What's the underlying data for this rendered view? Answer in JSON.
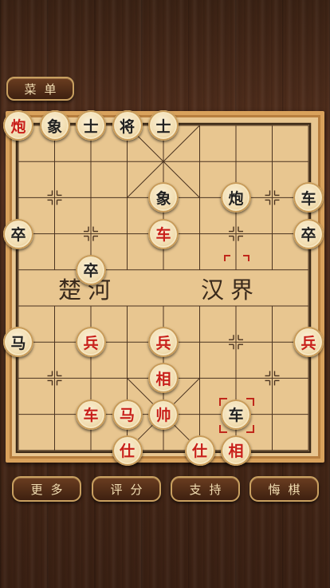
{
  "menu": {
    "label": "菜单"
  },
  "river": {
    "left": "楚河",
    "right": "汉界"
  },
  "bottom_bar": [
    {
      "id": "more",
      "label": "更多"
    },
    {
      "id": "rate",
      "label": "评分"
    },
    {
      "id": "support",
      "label": "支持"
    },
    {
      "id": "undo",
      "label": "悔棋"
    }
  ],
  "colors": {
    "red_piece_text": "#c81f1a",
    "black_piece_text": "#222222",
    "board": "#e8c690",
    "frame": "#d9a25c"
  },
  "pieces": [
    {
      "id": "b-pao",
      "text": "炮",
      "side": "red",
      "file": 0,
      "rank": 0
    },
    {
      "id": "b-xiang-top",
      "text": "象",
      "side": "black",
      "file": 1,
      "rank": 0
    },
    {
      "id": "b-shi-top-l",
      "text": "士",
      "side": "black",
      "file": 2,
      "rank": 0
    },
    {
      "id": "b-jiang",
      "text": "将",
      "side": "black",
      "file": 3,
      "rank": 0
    },
    {
      "id": "b-shi-top-r",
      "text": "士",
      "side": "black",
      "file": 4,
      "rank": 0
    },
    {
      "id": "b-xiang-mid",
      "text": "象",
      "side": "black",
      "file": 4,
      "rank": 2
    },
    {
      "id": "b-pao-r",
      "text": "炮",
      "side": "black",
      "file": 6,
      "rank": 2
    },
    {
      "id": "b-che-r",
      "text": "车",
      "side": "black",
      "file": 8,
      "rank": 2
    },
    {
      "id": "b-zu-l",
      "text": "卒",
      "side": "black",
      "file": 0,
      "rank": 3
    },
    {
      "id": "r-che-mid",
      "text": "车",
      "side": "red",
      "file": 4,
      "rank": 3
    },
    {
      "id": "b-zu-r",
      "text": "卒",
      "side": "black",
      "file": 8,
      "rank": 3
    },
    {
      "id": "b-zu-mid",
      "text": "卒",
      "side": "black",
      "file": 2,
      "rank": 4
    },
    {
      "id": "b-ma",
      "text": "马",
      "side": "black",
      "file": 0,
      "rank": 6
    },
    {
      "id": "r-bing-l",
      "text": "兵",
      "side": "red",
      "file": 2,
      "rank": 6
    },
    {
      "id": "r-bing-m",
      "text": "兵",
      "side": "red",
      "file": 4,
      "rank": 6
    },
    {
      "id": "r-bing-r",
      "text": "兵",
      "side": "red",
      "file": 8,
      "rank": 6
    },
    {
      "id": "r-xiang-mid",
      "text": "相",
      "side": "red",
      "file": 4,
      "rank": 7
    },
    {
      "id": "r-che-l",
      "text": "车",
      "side": "red",
      "file": 2,
      "rank": 8
    },
    {
      "id": "r-ma",
      "text": "马",
      "side": "red",
      "file": 3,
      "rank": 8
    },
    {
      "id": "r-shuai",
      "text": "帅",
      "side": "red",
      "file": 4,
      "rank": 8
    },
    {
      "id": "b-che-bottom",
      "text": "车",
      "side": "black",
      "file": 6,
      "rank": 8,
      "selected": true
    },
    {
      "id": "r-shi-l",
      "text": "仕",
      "side": "red",
      "file": 3,
      "rank": 9
    },
    {
      "id": "r-shi-r",
      "text": "仕",
      "side": "red",
      "file": 5,
      "rank": 9
    },
    {
      "id": "r-xiang-r",
      "text": "相",
      "side": "red",
      "file": 6,
      "rank": 9
    }
  ]
}
